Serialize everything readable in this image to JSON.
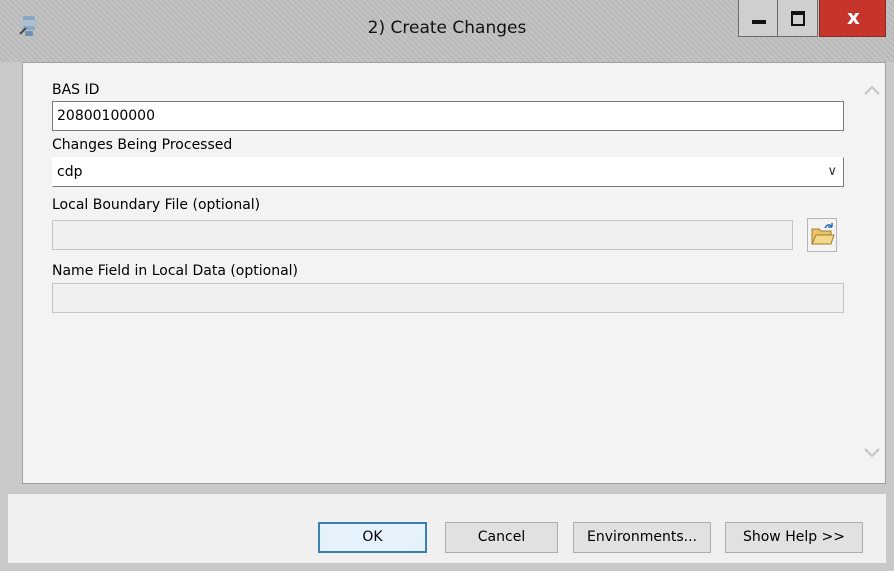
{
  "window": {
    "title": "2) Create Changes",
    "close_glyph": "x",
    "icons": {
      "app": "geoprocessing-tool-icon",
      "minimize": "minimize-icon",
      "maximize": "maximize-icon",
      "close": "close-icon"
    }
  },
  "form": {
    "bas_id": {
      "label": "BAS ID",
      "value": "20800100000"
    },
    "changes": {
      "label": "Changes Being Processed",
      "value": "cdp",
      "arrow": "∨"
    },
    "local_boundary": {
      "label": "Local Boundary File (optional)",
      "value": "",
      "browse_icon": "folder-open-icon"
    },
    "name_field": {
      "label": "Name Field in Local Data (optional)",
      "value": ""
    }
  },
  "scrollbar": {
    "up_icon": "chevron-up-icon",
    "down_icon": "chevron-down-icon"
  },
  "buttons": {
    "ok": "OK",
    "cancel": "Cancel",
    "environments": "Environments...",
    "show_help": "Show Help >>"
  },
  "colors": {
    "close_button": "#c7342c",
    "ok_border": "#3c7fb1"
  }
}
